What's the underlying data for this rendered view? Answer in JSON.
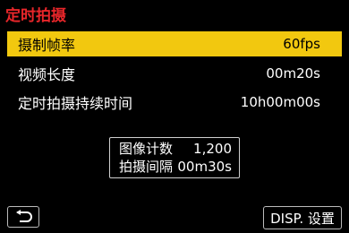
{
  "header": {
    "title": "定时拍摄"
  },
  "menu": [
    {
      "label": "摄制帧率",
      "value": "60fps",
      "selected": true
    },
    {
      "label": "视频长度",
      "value": "00m20s",
      "selected": false
    },
    {
      "label": "定时拍摄持续时间",
      "value": "10h00m00s",
      "selected": false
    }
  ],
  "info": {
    "image_count_label": "图像计数",
    "image_count_value": "1,200",
    "interval_label": "拍摄间隔",
    "interval_value": "00m30s"
  },
  "footer": {
    "back_icon": "back-arrow-icon",
    "disp_label": "DISP. 设置"
  },
  "colors": {
    "title": "#e8262a",
    "selected_bg": "#f2c80f",
    "background": "#000000"
  }
}
